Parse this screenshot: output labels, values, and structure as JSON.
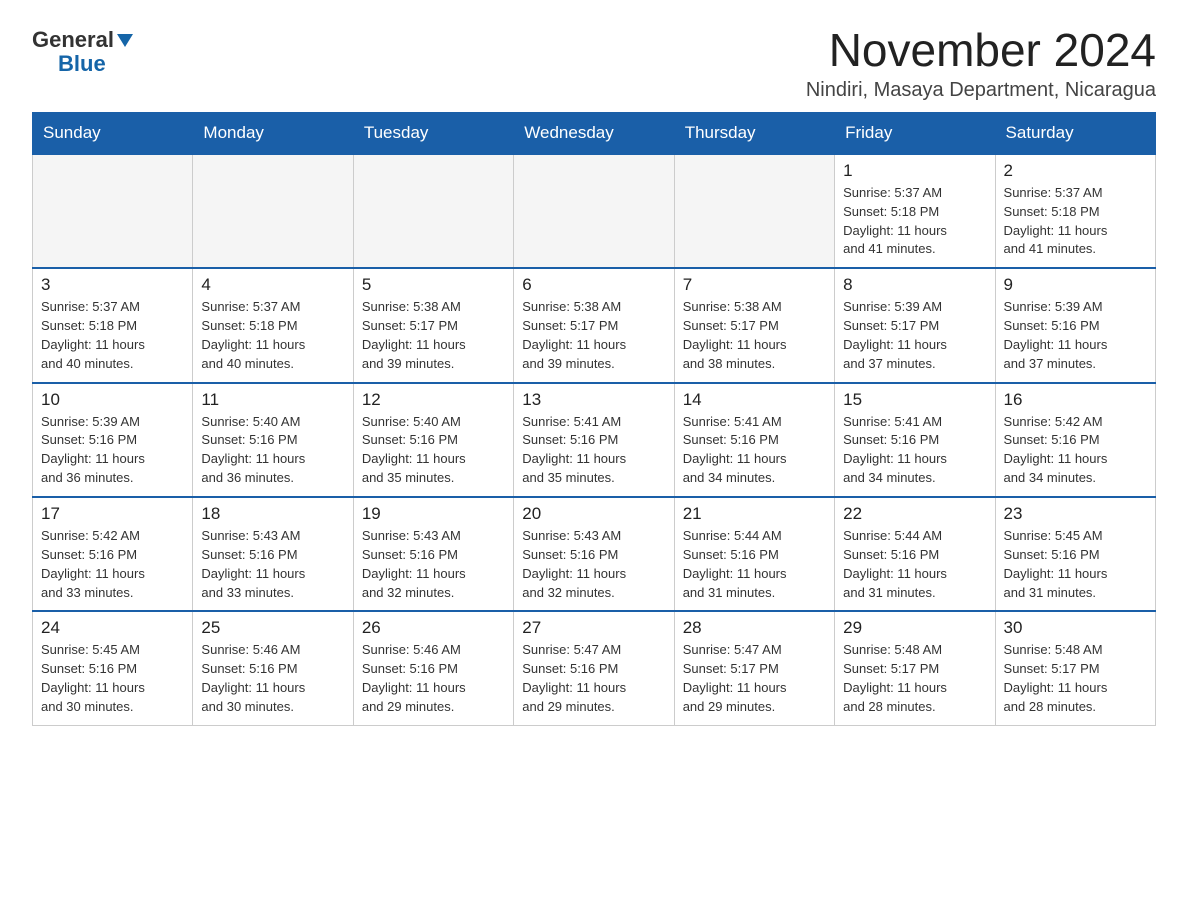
{
  "logo": {
    "general": "General",
    "arrow": "▼",
    "blue": "Blue"
  },
  "title": "November 2024",
  "location": "Nindiri, Masaya Department, Nicaragua",
  "days_of_week": [
    "Sunday",
    "Monday",
    "Tuesday",
    "Wednesday",
    "Thursday",
    "Friday",
    "Saturday"
  ],
  "weeks": [
    [
      {
        "day": "",
        "info": ""
      },
      {
        "day": "",
        "info": ""
      },
      {
        "day": "",
        "info": ""
      },
      {
        "day": "",
        "info": ""
      },
      {
        "day": "",
        "info": ""
      },
      {
        "day": "1",
        "info": "Sunrise: 5:37 AM\nSunset: 5:18 PM\nDaylight: 11 hours\nand 41 minutes."
      },
      {
        "day": "2",
        "info": "Sunrise: 5:37 AM\nSunset: 5:18 PM\nDaylight: 11 hours\nand 41 minutes."
      }
    ],
    [
      {
        "day": "3",
        "info": "Sunrise: 5:37 AM\nSunset: 5:18 PM\nDaylight: 11 hours\nand 40 minutes."
      },
      {
        "day": "4",
        "info": "Sunrise: 5:37 AM\nSunset: 5:18 PM\nDaylight: 11 hours\nand 40 minutes."
      },
      {
        "day": "5",
        "info": "Sunrise: 5:38 AM\nSunset: 5:17 PM\nDaylight: 11 hours\nand 39 minutes."
      },
      {
        "day": "6",
        "info": "Sunrise: 5:38 AM\nSunset: 5:17 PM\nDaylight: 11 hours\nand 39 minutes."
      },
      {
        "day": "7",
        "info": "Sunrise: 5:38 AM\nSunset: 5:17 PM\nDaylight: 11 hours\nand 38 minutes."
      },
      {
        "day": "8",
        "info": "Sunrise: 5:39 AM\nSunset: 5:17 PM\nDaylight: 11 hours\nand 37 minutes."
      },
      {
        "day": "9",
        "info": "Sunrise: 5:39 AM\nSunset: 5:16 PM\nDaylight: 11 hours\nand 37 minutes."
      }
    ],
    [
      {
        "day": "10",
        "info": "Sunrise: 5:39 AM\nSunset: 5:16 PM\nDaylight: 11 hours\nand 36 minutes."
      },
      {
        "day": "11",
        "info": "Sunrise: 5:40 AM\nSunset: 5:16 PM\nDaylight: 11 hours\nand 36 minutes."
      },
      {
        "day": "12",
        "info": "Sunrise: 5:40 AM\nSunset: 5:16 PM\nDaylight: 11 hours\nand 35 minutes."
      },
      {
        "day": "13",
        "info": "Sunrise: 5:41 AM\nSunset: 5:16 PM\nDaylight: 11 hours\nand 35 minutes."
      },
      {
        "day": "14",
        "info": "Sunrise: 5:41 AM\nSunset: 5:16 PM\nDaylight: 11 hours\nand 34 minutes."
      },
      {
        "day": "15",
        "info": "Sunrise: 5:41 AM\nSunset: 5:16 PM\nDaylight: 11 hours\nand 34 minutes."
      },
      {
        "day": "16",
        "info": "Sunrise: 5:42 AM\nSunset: 5:16 PM\nDaylight: 11 hours\nand 34 minutes."
      }
    ],
    [
      {
        "day": "17",
        "info": "Sunrise: 5:42 AM\nSunset: 5:16 PM\nDaylight: 11 hours\nand 33 minutes."
      },
      {
        "day": "18",
        "info": "Sunrise: 5:43 AM\nSunset: 5:16 PM\nDaylight: 11 hours\nand 33 minutes."
      },
      {
        "day": "19",
        "info": "Sunrise: 5:43 AM\nSunset: 5:16 PM\nDaylight: 11 hours\nand 32 minutes."
      },
      {
        "day": "20",
        "info": "Sunrise: 5:43 AM\nSunset: 5:16 PM\nDaylight: 11 hours\nand 32 minutes."
      },
      {
        "day": "21",
        "info": "Sunrise: 5:44 AM\nSunset: 5:16 PM\nDaylight: 11 hours\nand 31 minutes."
      },
      {
        "day": "22",
        "info": "Sunrise: 5:44 AM\nSunset: 5:16 PM\nDaylight: 11 hours\nand 31 minutes."
      },
      {
        "day": "23",
        "info": "Sunrise: 5:45 AM\nSunset: 5:16 PM\nDaylight: 11 hours\nand 31 minutes."
      }
    ],
    [
      {
        "day": "24",
        "info": "Sunrise: 5:45 AM\nSunset: 5:16 PM\nDaylight: 11 hours\nand 30 minutes."
      },
      {
        "day": "25",
        "info": "Sunrise: 5:46 AM\nSunset: 5:16 PM\nDaylight: 11 hours\nand 30 minutes."
      },
      {
        "day": "26",
        "info": "Sunrise: 5:46 AM\nSunset: 5:16 PM\nDaylight: 11 hours\nand 29 minutes."
      },
      {
        "day": "27",
        "info": "Sunrise: 5:47 AM\nSunset: 5:16 PM\nDaylight: 11 hours\nand 29 minutes."
      },
      {
        "day": "28",
        "info": "Sunrise: 5:47 AM\nSunset: 5:17 PM\nDaylight: 11 hours\nand 29 minutes."
      },
      {
        "day": "29",
        "info": "Sunrise: 5:48 AM\nSunset: 5:17 PM\nDaylight: 11 hours\nand 28 minutes."
      },
      {
        "day": "30",
        "info": "Sunrise: 5:48 AM\nSunset: 5:17 PM\nDaylight: 11 hours\nand 28 minutes."
      }
    ]
  ],
  "colors": {
    "header_bg": "#1a5fa8",
    "header_text": "#ffffff",
    "border": "#1a5fa8",
    "cell_border": "#cccccc",
    "empty_cell_bg": "#f5f5f5"
  }
}
